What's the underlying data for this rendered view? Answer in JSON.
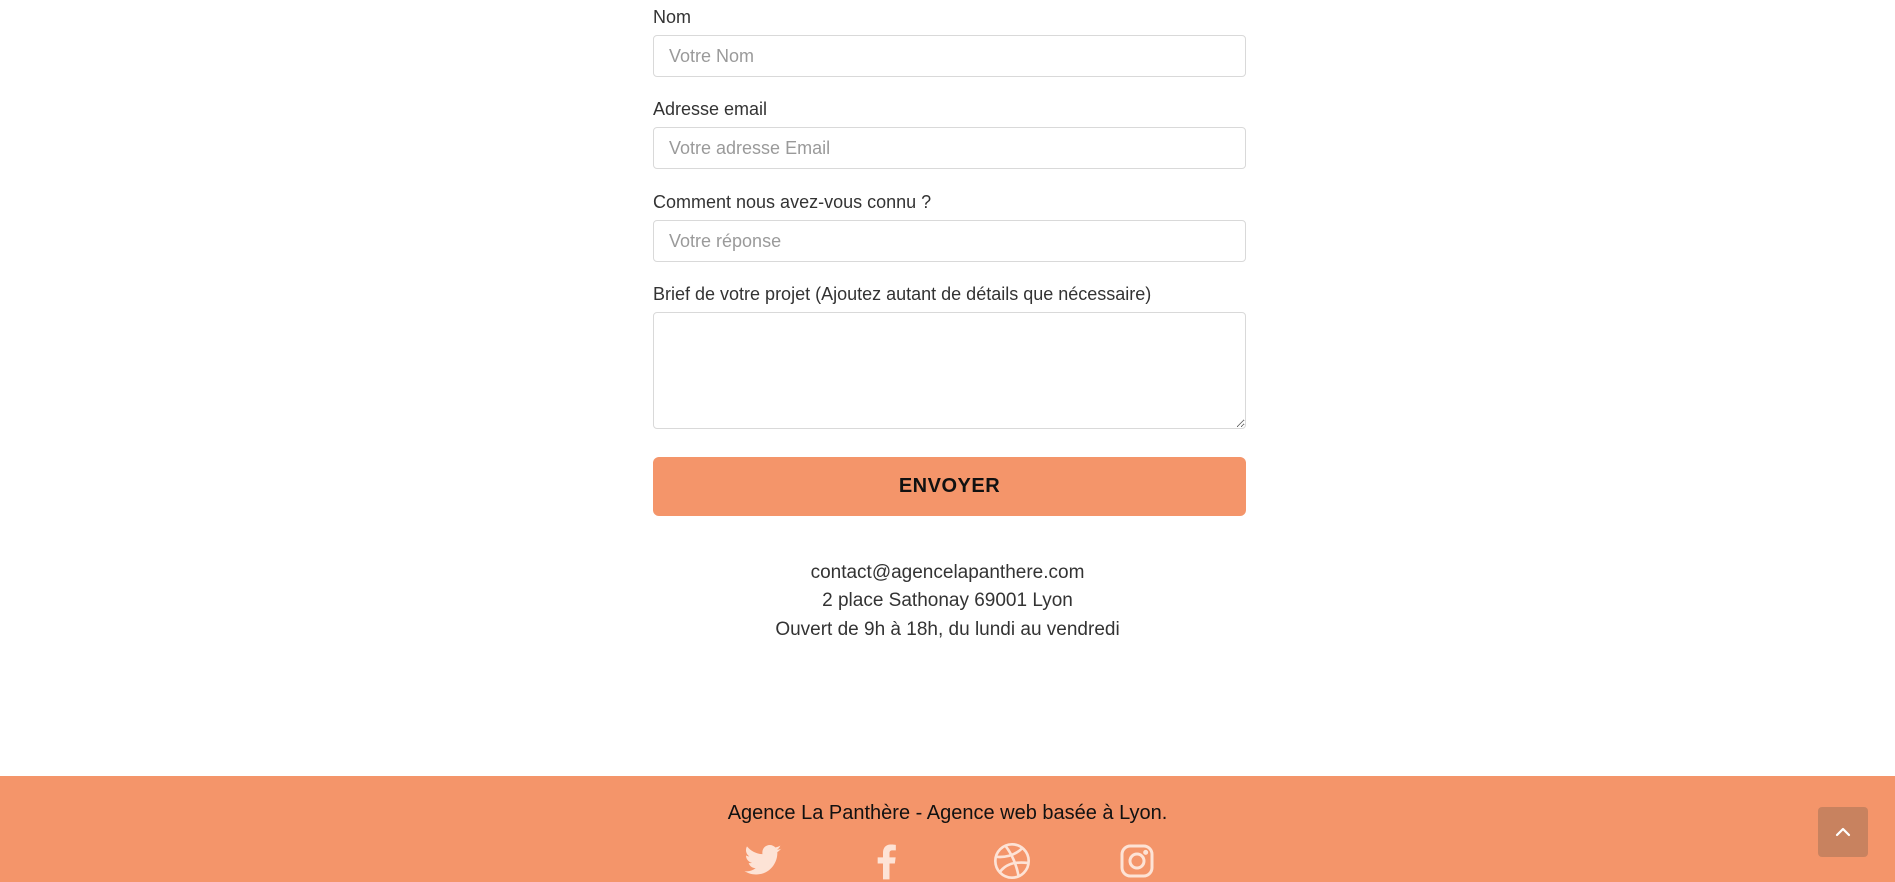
{
  "form": {
    "name_label": "Nom",
    "name_placeholder": "Votre Nom",
    "email_label": "Adresse email",
    "email_placeholder": "Votre adresse Email",
    "source_label": "Comment nous avez-vous connu ?",
    "source_placeholder": "Votre réponse",
    "brief_label": "Brief de votre projet (Ajoutez autant de détails que nécessaire)",
    "brief_value": "",
    "submit_label": "ENVOYER"
  },
  "contact": {
    "email": "contact@agencelapanthere.com",
    "address": "2 place Sathonay 69001 Lyon",
    "hours": "Ouvert de 9h à 18h, du lundi au vendredi"
  },
  "footer": {
    "tagline": "Agence La Panthère - Agence web basée à Lyon.",
    "social_icons": [
      "twitter-icon",
      "facebook-icon",
      "dribbble-icon",
      "instagram-icon"
    ]
  },
  "colors": {
    "accent": "#f4956a",
    "scroll_button": "#c8825f",
    "social_icon": "#fde3d6"
  }
}
